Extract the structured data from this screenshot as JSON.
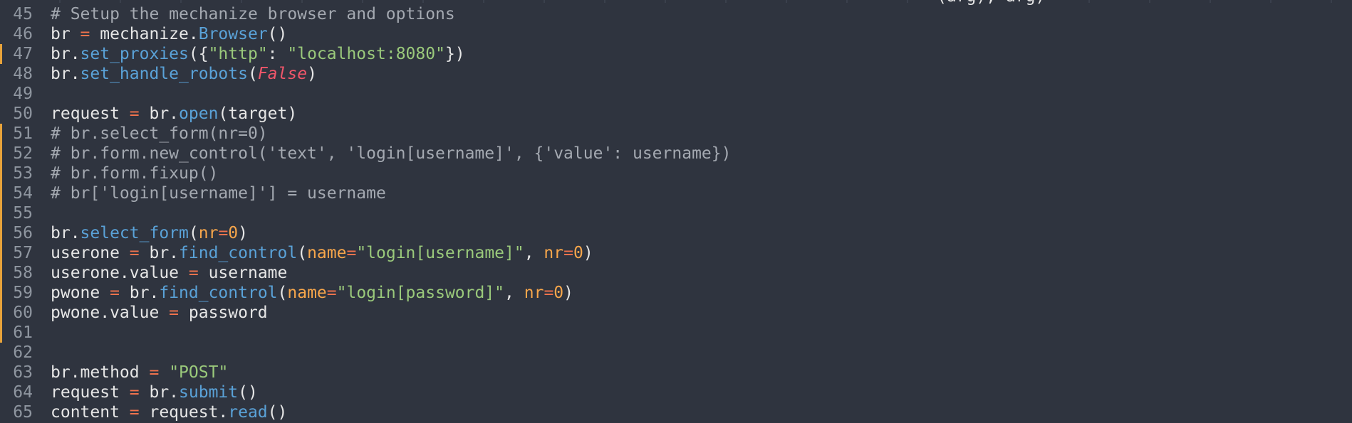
{
  "editor": {
    "top_fragment": "(arg), arg)",
    "lines": [
      {
        "number": "45",
        "changed": false,
        "tokens": [
          {
            "t": "# Setup the mechanize browser and options",
            "c": "cmt"
          }
        ]
      },
      {
        "number": "46",
        "changed": false,
        "tokens": [
          {
            "t": "br ",
            "c": "plain"
          },
          {
            "t": "=",
            "c": "op"
          },
          {
            "t": " mechanize.",
            "c": "plain"
          },
          {
            "t": "Browser",
            "c": "fn"
          },
          {
            "t": "()",
            "c": "plain"
          }
        ]
      },
      {
        "number": "47",
        "changed": true,
        "tokens": [
          {
            "t": "br.",
            "c": "plain"
          },
          {
            "t": "set_proxies",
            "c": "fn"
          },
          {
            "t": "({",
            "c": "plain"
          },
          {
            "t": "\"http\"",
            "c": "str"
          },
          {
            "t": ": ",
            "c": "plain"
          },
          {
            "t": "\"localhost:8080\"",
            "c": "str"
          },
          {
            "t": "})",
            "c": "plain"
          }
        ]
      },
      {
        "number": "48",
        "changed": false,
        "tokens": [
          {
            "t": "br.",
            "c": "plain"
          },
          {
            "t": "set_handle_robots",
            "c": "fn"
          },
          {
            "t": "(",
            "c": "plain"
          },
          {
            "t": "False",
            "c": "bool"
          },
          {
            "t": ")",
            "c": "plain"
          }
        ]
      },
      {
        "number": "49",
        "changed": false,
        "tokens": []
      },
      {
        "number": "50",
        "changed": false,
        "tokens": [
          {
            "t": "request ",
            "c": "plain"
          },
          {
            "t": "=",
            "c": "op"
          },
          {
            "t": " br.",
            "c": "plain"
          },
          {
            "t": "open",
            "c": "fn"
          },
          {
            "t": "(target)",
            "c": "plain"
          }
        ]
      },
      {
        "number": "51",
        "changed": true,
        "tokens": [
          {
            "t": "# br.select_form(nr=0)",
            "c": "cmt"
          }
        ]
      },
      {
        "number": "52",
        "changed": true,
        "tokens": [
          {
            "t": "# br.form.new_control('text', 'login[username]', {'value': username})",
            "c": "cmt"
          }
        ]
      },
      {
        "number": "53",
        "changed": true,
        "tokens": [
          {
            "t": "# br.form.fixup()",
            "c": "cmt"
          }
        ]
      },
      {
        "number": "54",
        "changed": true,
        "tokens": [
          {
            "t": "# br['login[username]'] = username",
            "c": "cmt"
          }
        ]
      },
      {
        "number": "55",
        "changed": true,
        "tokens": []
      },
      {
        "number": "56",
        "changed": true,
        "tokens": [
          {
            "t": "br.",
            "c": "plain"
          },
          {
            "t": "select_form",
            "c": "fn"
          },
          {
            "t": "(",
            "c": "plain"
          },
          {
            "t": "nr",
            "c": "kw"
          },
          {
            "t": "=",
            "c": "op"
          },
          {
            "t": "0",
            "c": "num"
          },
          {
            "t": ")",
            "c": "plain"
          }
        ]
      },
      {
        "number": "57",
        "changed": true,
        "tokens": [
          {
            "t": "userone ",
            "c": "plain"
          },
          {
            "t": "=",
            "c": "op"
          },
          {
            "t": " br.",
            "c": "plain"
          },
          {
            "t": "find_control",
            "c": "fn"
          },
          {
            "t": "(",
            "c": "plain"
          },
          {
            "t": "name",
            "c": "kw"
          },
          {
            "t": "=",
            "c": "op"
          },
          {
            "t": "\"login[username]\"",
            "c": "str"
          },
          {
            "t": ", ",
            "c": "plain"
          },
          {
            "t": "nr",
            "c": "kw"
          },
          {
            "t": "=",
            "c": "op"
          },
          {
            "t": "0",
            "c": "num"
          },
          {
            "t": ")",
            "c": "plain"
          }
        ]
      },
      {
        "number": "58",
        "changed": true,
        "tokens": [
          {
            "t": "userone.value ",
            "c": "plain"
          },
          {
            "t": "=",
            "c": "op"
          },
          {
            "t": " username",
            "c": "plain"
          }
        ]
      },
      {
        "number": "59",
        "changed": true,
        "tokens": [
          {
            "t": "pwone ",
            "c": "plain"
          },
          {
            "t": "=",
            "c": "op"
          },
          {
            "t": " br.",
            "c": "plain"
          },
          {
            "t": "find_control",
            "c": "fn"
          },
          {
            "t": "(",
            "c": "plain"
          },
          {
            "t": "name",
            "c": "kw"
          },
          {
            "t": "=",
            "c": "op"
          },
          {
            "t": "\"login[password]\"",
            "c": "str"
          },
          {
            "t": ", ",
            "c": "plain"
          },
          {
            "t": "nr",
            "c": "kw"
          },
          {
            "t": "=",
            "c": "op"
          },
          {
            "t": "0",
            "c": "num"
          },
          {
            "t": ")",
            "c": "plain"
          }
        ]
      },
      {
        "number": "60",
        "changed": true,
        "tokens": [
          {
            "t": "pwone.value ",
            "c": "plain"
          },
          {
            "t": "=",
            "c": "op"
          },
          {
            "t": " password",
            "c": "plain"
          }
        ]
      },
      {
        "number": "61",
        "changed": true,
        "tokens": []
      },
      {
        "number": "62",
        "changed": false,
        "tokens": []
      },
      {
        "number": "63",
        "changed": false,
        "tokens": [
          {
            "t": "br.method ",
            "c": "plain"
          },
          {
            "t": "=",
            "c": "op"
          },
          {
            "t": " ",
            "c": "plain"
          },
          {
            "t": "\"POST\"",
            "c": "str"
          }
        ]
      },
      {
        "number": "64",
        "changed": false,
        "tokens": [
          {
            "t": "request ",
            "c": "plain"
          },
          {
            "t": "=",
            "c": "op"
          },
          {
            "t": " br.",
            "c": "plain"
          },
          {
            "t": "submit",
            "c": "fn"
          },
          {
            "t": "()",
            "c": "plain"
          }
        ]
      },
      {
        "number": "65",
        "changed": false,
        "tokens": [
          {
            "t": "content ",
            "c": "plain"
          },
          {
            "t": "=",
            "c": "op"
          },
          {
            "t": " request.",
            "c": "plain"
          },
          {
            "t": "read",
            "c": "fn"
          },
          {
            "t": "()",
            "c": "plain"
          }
        ]
      }
    ]
  },
  "colors": {
    "background": "#2f343f",
    "gutter_change_marker": "#e8a33a",
    "comment": "#a4a9b1",
    "operator": "#f2734d",
    "function": "#5aa2d8",
    "string": "#9ac97b",
    "keyword_arg": "#f7a64b",
    "boolean": "#f0566a"
  }
}
